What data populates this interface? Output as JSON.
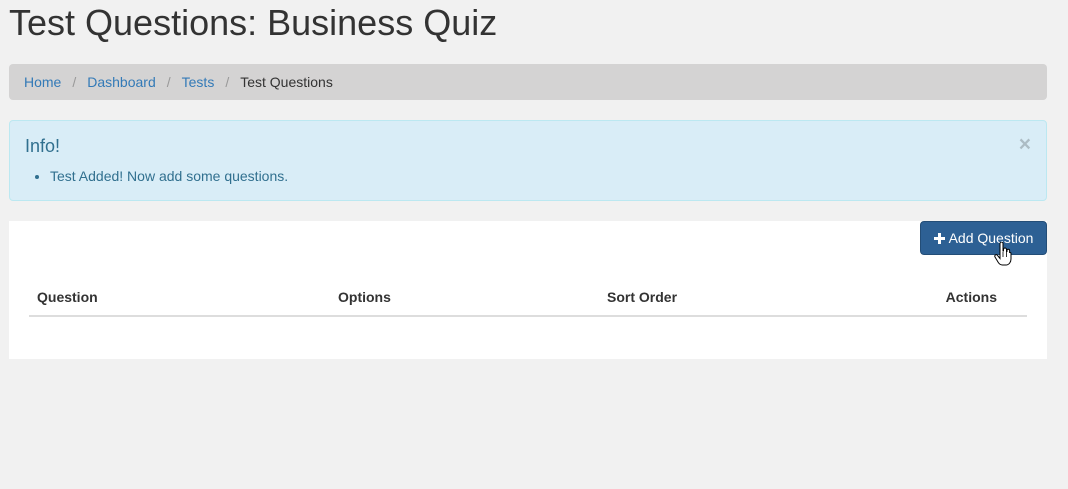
{
  "page": {
    "title": "Test Questions: Business Quiz"
  },
  "breadcrumb": {
    "items": [
      {
        "label": "Home"
      },
      {
        "label": "Dashboard"
      },
      {
        "label": "Tests"
      }
    ],
    "separator": "/",
    "active": "Test Questions"
  },
  "alert": {
    "title": "Info!",
    "messages": [
      "Test Added! Now add some questions."
    ],
    "close_glyph": "×",
    "color": "#31708f",
    "background": "#d9edf7"
  },
  "toolbar": {
    "add_question_label": "Add Question",
    "add_question_icon": "plus-icon",
    "button_color": "#2d6094"
  },
  "table": {
    "columns": [
      "Question",
      "Options",
      "Sort Order",
      "Actions"
    ],
    "rows": []
  }
}
